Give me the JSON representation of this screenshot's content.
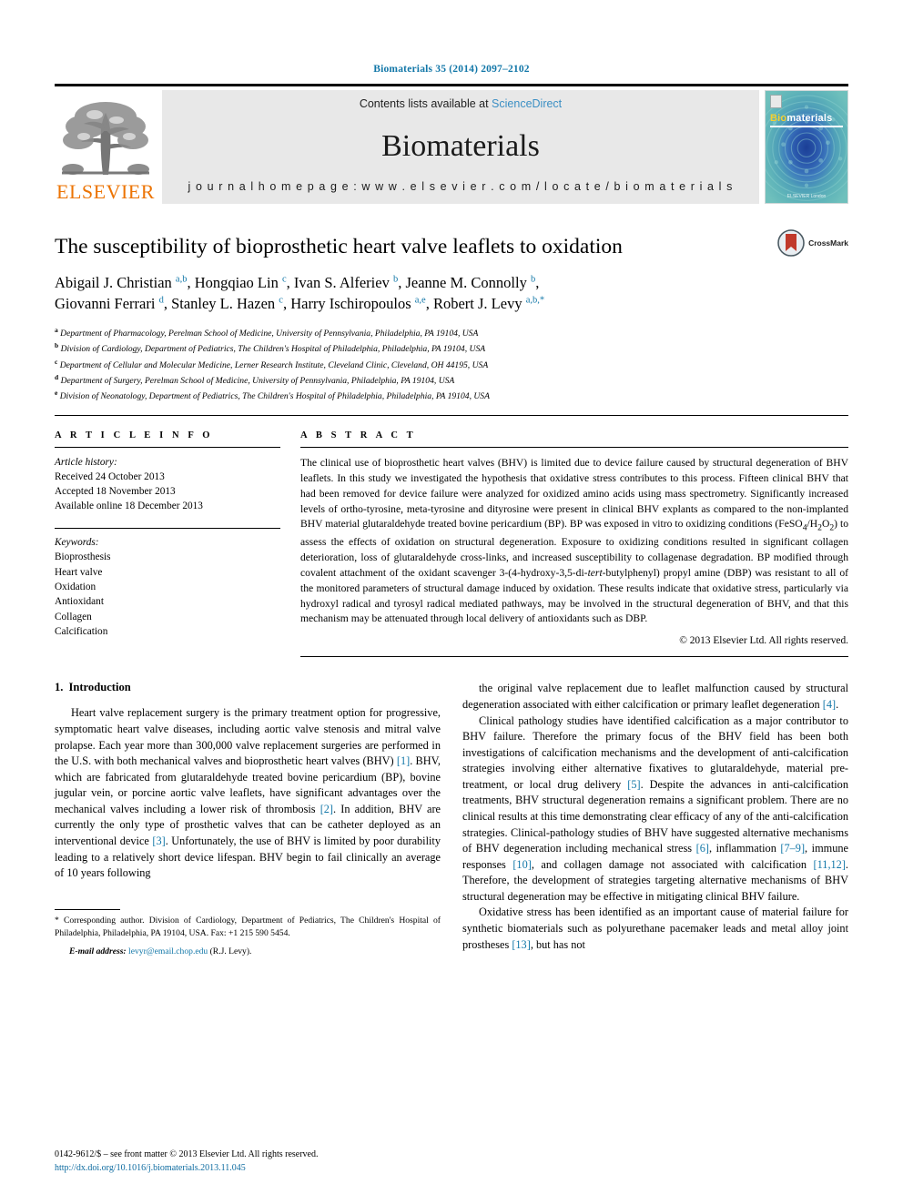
{
  "running_head": "Biomaterials 35 (2014) 2097–2102",
  "masthead": {
    "publisher_name": "ELSEVIER",
    "contents_prefix": "Contents lists available at ",
    "contents_link": "ScienceDirect",
    "journal_name": "Biomaterials",
    "homepage": "j o u r n a l   h o m e p a g e :   w w w . e l s e v i e r . c o m / l o c a t e / b i o m a t e r i a l s",
    "cover": {
      "title_part1": "Bio",
      "title_part2": "materials",
      "footer": "ELSEVIER\nLondon"
    }
  },
  "article": {
    "title": "The susceptibility of bioprosthetic heart valve leaflets to oxidation",
    "crossmark_label": "CrossMark",
    "authors_line1": "Abigail J. Christian <sup>a,b</sup>, Hongqiao Lin <sup>c</sup>, Ivan S. Alferiev <sup>b</sup>, Jeanne M. Connolly <sup>b</sup>,",
    "authors_line2": "Giovanni Ferrari <sup>d</sup>, Stanley L. Hazen <sup>c</sup>, Harry Ischiropoulos <sup>a,e</sup>, Robert J. Levy <sup>a,b,*</sup>",
    "affiliations": [
      "<sup>a</sup> Department of Pharmacology, Perelman School of Medicine, University of Pennsylvania, Philadelphia, PA 19104, USA",
      "<sup>b</sup> Division of Cardiology, Department of Pediatrics, The Children's Hospital of Philadelphia, Philadelphia, PA 19104, USA",
      "<sup>c</sup> Department of Cellular and Molecular Medicine, Lerner Research Institute, Cleveland Clinic, Cleveland, OH 44195, USA",
      "<sup>d</sup> Department of Surgery, Perelman School of Medicine, University of Pennsylvania, Philadelphia, PA 19104, USA",
      "<sup>e</sup> Division of Neonatology, Department of Pediatrics, The Children's Hospital of Philadelphia, Philadelphia, PA 19104, USA"
    ]
  },
  "article_info": {
    "heading": "A R T I C L E   I N F O",
    "history_label": "Article history:",
    "history": [
      "Received 24 October 2013",
      "Accepted 18 November 2013",
      "Available online 18 December 2013"
    ],
    "keywords_label": "Keywords:",
    "keywords": [
      "Bioprosthesis",
      "Heart valve",
      "Oxidation",
      "Antioxidant",
      "Collagen",
      "Calcification"
    ]
  },
  "abstract": {
    "heading": "A B S T R A C T",
    "text": "The clinical use of bioprosthetic heart valves (BHV) is limited due to device failure caused by structural degeneration of BHV leaflets. In this study we investigated the hypothesis that oxidative stress contributes to this process. Fifteen clinical BHV that had been removed for device failure were analyzed for oxidized amino acids using mass spectrometry. Significantly increased levels of ortho-tyrosine, meta-tyrosine and dityrosine were present in clinical BHV explants as compared to the non-implanted BHV material glutaraldehyde treated bovine pericardium (BP). BP was exposed in vitro to oxidizing conditions (FeSO<sub>4</sub>/H<sub>2</sub>O<sub>2</sub>) to assess the effects of oxidation on structural degeneration. Exposure to oxidizing conditions resulted in significant collagen deterioration, loss of glutaraldehyde cross-links, and increased susceptibility to collagenase degradation. BP modified through covalent attachment of the oxidant scavenger 3-(4-hydroxy-3,5-di-<i>tert</i>-butylphenyl) propyl amine (DBP) was resistant to all of the monitored parameters of structural damage induced by oxidation. These results indicate that oxidative stress, particularly via hydroxyl radical and tyrosyl radical mediated pathways, may be involved in the structural degeneration of BHV, and that this mechanism may be attenuated through local delivery of antioxidants such as DBP.",
    "copyright": "© 2013 Elsevier Ltd. All rights reserved."
  },
  "introduction": {
    "number": "1.",
    "heading": "Introduction",
    "left_paragraphs": [
      "Heart valve replacement surgery is the primary treatment option for progressive, symptomatic heart valve diseases, including aortic valve stenosis and mitral valve prolapse. Each year more than 300,000 valve replacement surgeries are performed in the U.S. with both mechanical valves and bioprosthetic heart valves (BHV) <span class=\"ref\">[1]</span>. BHV, which are fabricated from glutaraldehyde treated bovine pericardium (BP), bovine jugular vein, or porcine aortic valve leaflets, have significant advantages over the mechanical valves including a lower risk of thrombosis <span class=\"ref\">[2]</span>. In addition, BHV are currently the only type of prosthetic valves that can be catheter deployed as an interventional device <span class=\"ref\">[3]</span>. Unfortunately, the use of BHV is limited by poor durability leading to a relatively short device lifespan. BHV begin to fail clinically an average of 10 years following"
    ],
    "right_paragraphs": [
      "the original valve replacement due to leaflet malfunction caused by structural degeneration associated with either calcification or primary leaflet degeneration <span class=\"ref\">[4]</span>.",
      "Clinical pathology studies have identified calcification as a major contributor to BHV failure. Therefore the primary focus of the BHV field has been both investigations of calcification mechanisms and the development of anti-calcification strategies involving either alternative fixatives to glutaraldehyde, material pre-treatment, or local drug delivery <span class=\"ref\">[5]</span>. Despite the advances in anti-calcification treatments, BHV structural degeneration remains a significant problem. There are no clinical results at this time demonstrating clear efficacy of any of the anti-calcification strategies. Clinical-pathology studies of BHV have suggested alternative mechanisms of BHV degeneration including mechanical stress <span class=\"ref\">[6]</span>, inflammation <span class=\"ref\">[7–9]</span>, immune responses <span class=\"ref\">[10]</span>, and collagen damage not associated with calcification <span class=\"ref\">[11,12]</span>. Therefore, the development of strategies targeting alternative mechanisms of BHV structural degeneration may be effective in mitigating clinical BHV failure.",
      "Oxidative stress has been identified as an important cause of material failure for synthetic biomaterials such as polyurethane pacemaker leads and metal alloy joint prostheses <span class=\"ref\">[13]</span>, but has not"
    ]
  },
  "footnote": {
    "corresponding": "<span class=\"star\">*</span> Corresponding author. Division of Cardiology, Department of Pediatrics, The Children's Hospital of Philadelphia, Philadelphia, PA 19104, USA. Fax: +1 215 590 5454.",
    "email_label": "E-mail address:",
    "email": "levyr@email.chop.edu",
    "email_suffix": "(R.J. Levy)."
  },
  "imprint": {
    "line1": "0142-9612/$ – see front matter © 2013 Elsevier Ltd. All rights reserved.",
    "doi": "http://dx.doi.org/10.1016/j.biomaterials.2013.11.045"
  },
  "colors": {
    "link_blue": "#1277a8",
    "sciencedirect_blue": "#3b8fc4",
    "elsevier_orange": "#ec7404",
    "doi_blue": "#0d6ba0",
    "cover_teal": "#5fb4b9",
    "crossmark_red": "#c0392b"
  }
}
